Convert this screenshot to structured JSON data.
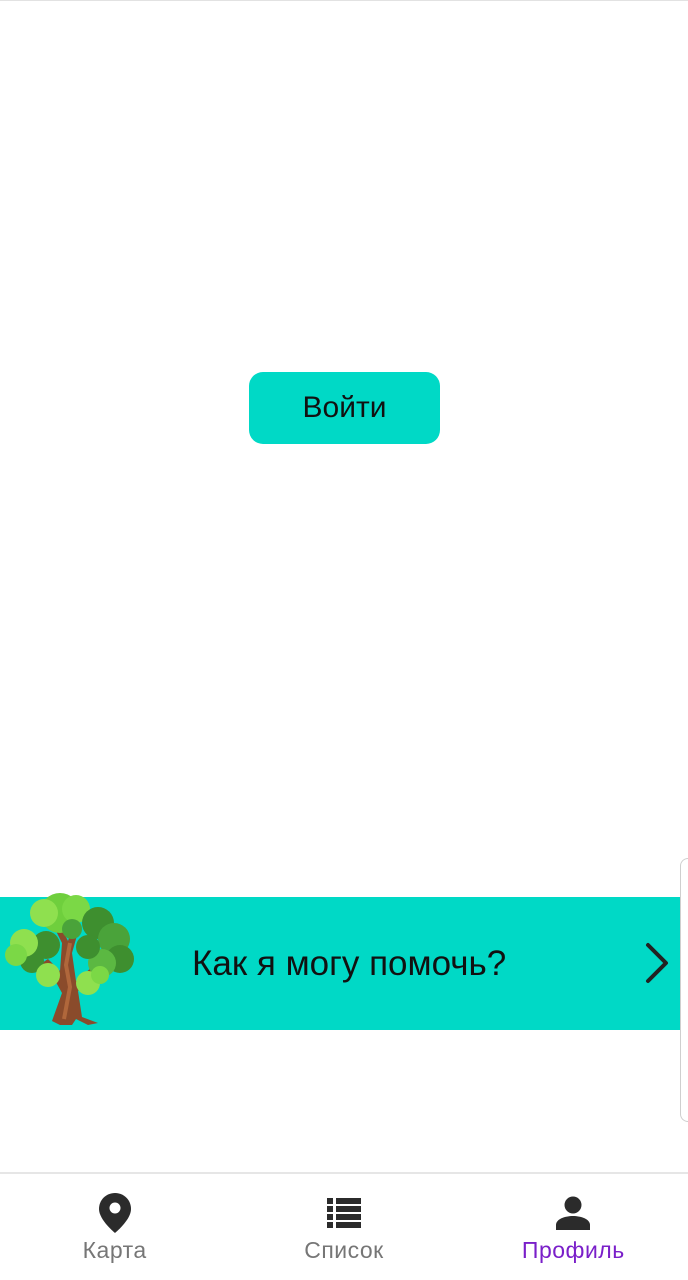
{
  "main": {
    "login_label": "Войти"
  },
  "banner": {
    "text": "Как я могу помочь?",
    "icon": "tree-icon",
    "arrow_icon": "chevron-right-icon",
    "color": "#00d9c6"
  },
  "bottom_nav": {
    "active_color": "#7a1fc9",
    "items": [
      {
        "label": "Карта",
        "icon": "map-pin-icon",
        "active": false
      },
      {
        "label": "Список",
        "icon": "list-icon",
        "active": false
      },
      {
        "label": "Профиль",
        "icon": "person-icon",
        "active": true
      }
    ]
  }
}
